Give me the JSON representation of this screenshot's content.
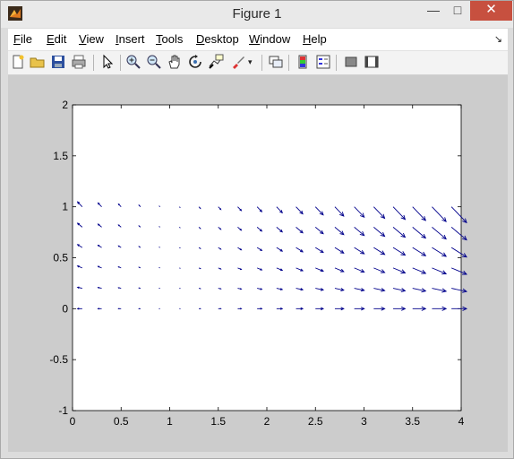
{
  "window": {
    "title": "Figure 1",
    "minimize_glyph": "—",
    "maximize_glyph": "□",
    "close_glyph": "✕"
  },
  "menu": {
    "items": [
      {
        "label": "File",
        "mnemonic": "F",
        "rest": "ile"
      },
      {
        "label": "Edit",
        "mnemonic": "E",
        "rest": "dit"
      },
      {
        "label": "View",
        "mnemonic": "V",
        "rest": "iew"
      },
      {
        "label": "Insert",
        "mnemonic": "I",
        "rest": "nsert"
      },
      {
        "label": "Tools",
        "mnemonic": "T",
        "rest": "ools"
      },
      {
        "label": "Desktop",
        "mnemonic": "D",
        "rest": "esktop"
      },
      {
        "label": "Window",
        "mnemonic": "W",
        "rest": "indow"
      },
      {
        "label": "Help",
        "mnemonic": "H",
        "rest": "elp"
      }
    ],
    "dock_glyph": "↘"
  },
  "toolbar": {
    "icons": [
      "new-figure-icon",
      "open-file-icon",
      "save-icon",
      "print-icon",
      "edit-plot-icon",
      "zoom-in-icon",
      "zoom-out-icon",
      "pan-icon",
      "rotate-3d-icon",
      "data-cursor-icon",
      "brush-icon",
      "link-plot-icon",
      "colorbar-icon",
      "legend-icon",
      "hide-plot-tools-icon",
      "show-plot-tools-icon"
    ]
  },
  "colors": {
    "arrow": "#00008b",
    "axes_bg": "#ffffff",
    "figure_bg": "#cccccc"
  },
  "chart_data": {
    "type": "quiver",
    "title": "",
    "xlabel": "",
    "ylabel": "",
    "xlim": [
      0,
      4
    ],
    "ylim": [
      -1,
      2
    ],
    "xticks": [
      "0",
      "0.5",
      "1",
      "1.5",
      "2",
      "2.5",
      "3",
      "3.5",
      "4"
    ],
    "yticks": [
      "-1",
      "-0.5",
      "0",
      "0.5",
      "1",
      "1.5",
      "2"
    ],
    "grid": false,
    "x": [
      0.1,
      0.3,
      0.5,
      0.7,
      0.9,
      1.1,
      1.3,
      1.5,
      1.7,
      1.9,
      2.1,
      2.3,
      2.5,
      2.7,
      2.9,
      3.1,
      3.3,
      3.5,
      3.7,
      3.9
    ],
    "y": [
      0,
      0.2,
      0.4,
      0.6,
      0.8,
      1.0
    ],
    "u_formula": "x - 1",
    "v_formula": "y * (1 - x)"
  }
}
